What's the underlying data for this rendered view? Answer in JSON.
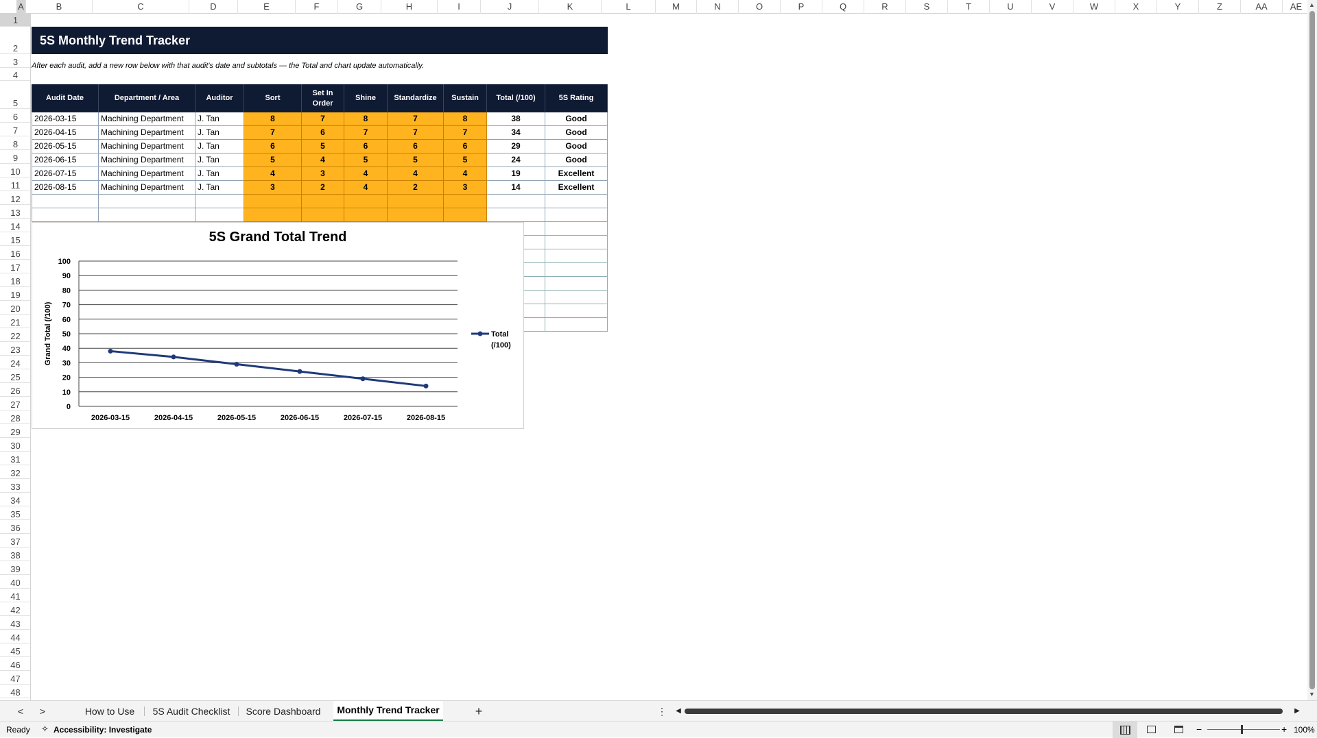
{
  "columns": [
    "A",
    "B",
    "C",
    "D",
    "E",
    "F",
    "G",
    "H",
    "I",
    "J",
    "K",
    "L",
    "M",
    "N",
    "O",
    "P",
    "Q",
    "R",
    "S",
    "T",
    "U",
    "V",
    "W",
    "X",
    "Y",
    "Z",
    "AA",
    "AE"
  ],
  "rows": [
    "1",
    "2",
    "3",
    "4",
    "5",
    "6",
    "7",
    "8",
    "9",
    "10",
    "11",
    "12",
    "13",
    "14",
    "15",
    "16",
    "17",
    "18",
    "19",
    "20",
    "21",
    "22",
    "23",
    "24",
    "25",
    "26",
    "27",
    "28",
    "29",
    "30",
    "31",
    "32",
    "33",
    "34",
    "35",
    "36",
    "37",
    "38",
    "39",
    "40",
    "41",
    "42",
    "43",
    "44",
    "45",
    "46",
    "47",
    "48"
  ],
  "sheet": {
    "title": "5S Monthly Trend Tracker",
    "instruction": "After each audit, add a new row below with that audit's date and subtotals — the Total and chart update automatically.",
    "headers": [
      "Audit Date",
      "Department / Area",
      "Auditor",
      "Sort",
      "Set In Order",
      "Shine",
      "Standardize",
      "Sustain",
      "Total (/100)",
      "5S Rating"
    ],
    "data_rows": [
      [
        "2026-03-15",
        "Machining Department",
        "J. Tan",
        "8",
        "7",
        "8",
        "7",
        "8",
        "38",
        "Good"
      ],
      [
        "2026-04-15",
        "Machining Department",
        "J. Tan",
        "7",
        "6",
        "7",
        "7",
        "7",
        "34",
        "Good"
      ],
      [
        "2026-05-15",
        "Machining Department",
        "J. Tan",
        "6",
        "5",
        "6",
        "6",
        "6",
        "29",
        "Good"
      ],
      [
        "2026-06-15",
        "Machining Department",
        "J. Tan",
        "5",
        "4",
        "5",
        "5",
        "5",
        "24",
        "Good"
      ],
      [
        "2026-07-15",
        "Machining Department",
        "J. Tan",
        "4",
        "3",
        "4",
        "4",
        "4",
        "19",
        "Excellent"
      ],
      [
        "2026-08-15",
        "Machining Department",
        "J. Tan",
        "3",
        "2",
        "4",
        "2",
        "3",
        "14",
        "Excellent"
      ]
    ]
  },
  "chart_data": {
    "type": "line",
    "title": "5S Grand Total Trend",
    "xlabel": "",
    "ylabel": "Grand Total (/100)",
    "categories": [
      "2026-03-15",
      "2026-04-15",
      "2026-05-15",
      "2026-06-15",
      "2026-07-15",
      "2026-08-15"
    ],
    "series": [
      {
        "name": "Total (/100)",
        "values": [
          38,
          34,
          29,
          24,
          19,
          14
        ]
      }
    ],
    "ylim": [
      0,
      100
    ],
    "yticks": [
      "0",
      "10",
      "20",
      "30",
      "40",
      "50",
      "60",
      "70",
      "80",
      "90",
      "100"
    ],
    "grid": true,
    "legend_position": "right",
    "line_color": "#1f3a7a"
  },
  "tabs": {
    "items": [
      "How to Use",
      "5S Audit Checklist",
      "Score Dashboard",
      "Monthly Trend Tracker"
    ],
    "active": "Monthly Trend Tracker",
    "add_label": "+"
  },
  "status": {
    "ready": "Ready",
    "accessibility": "Accessibility: Investigate",
    "zoom": "100%"
  }
}
